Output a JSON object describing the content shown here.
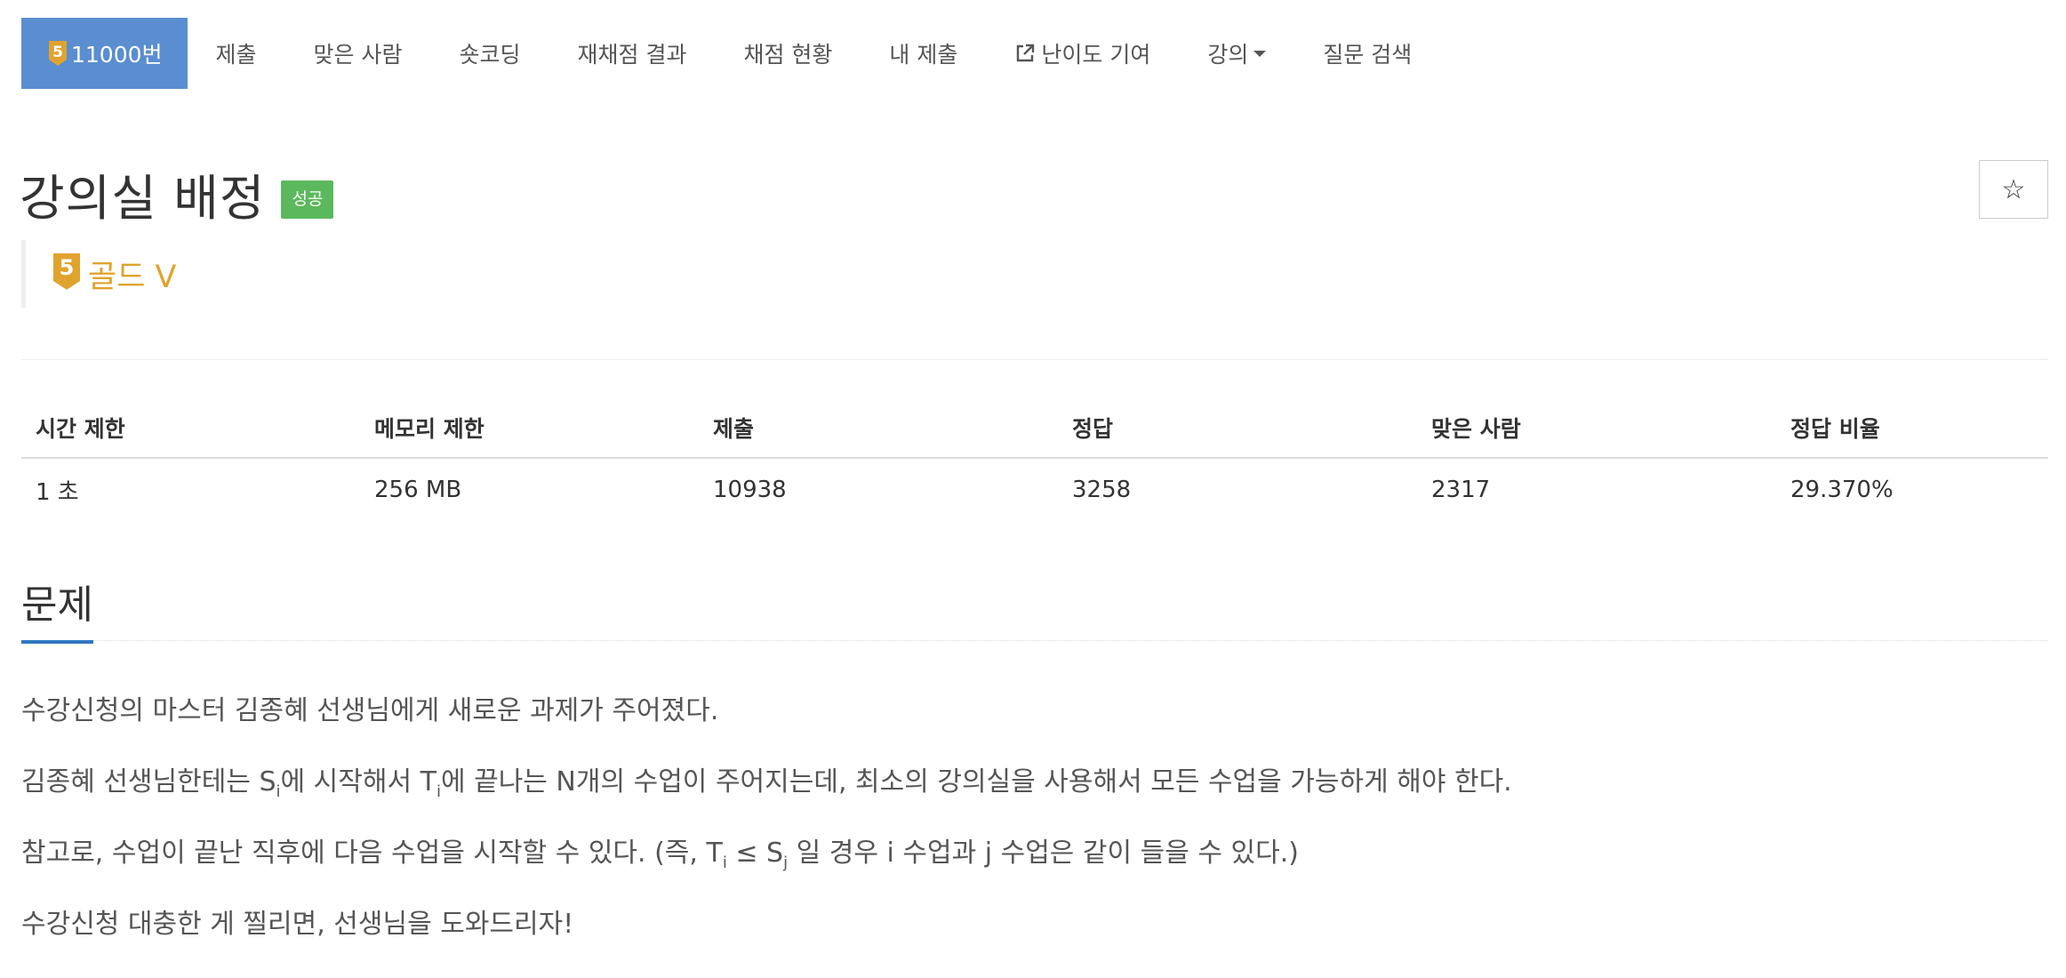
{
  "nav": {
    "problem_number": "11000번",
    "tier_number": "5",
    "items": [
      "제출",
      "맞은 사람",
      "숏코딩",
      "재채점 결과",
      "채점 현황",
      "내 제출",
      "난이도 기여",
      "강의",
      "질문 검색"
    ]
  },
  "title": "강의실 배정",
  "status_badge": "성공",
  "tier": {
    "number": "5",
    "label": "골드 V",
    "color": "#e0a32e"
  },
  "star_icon": "☆",
  "info_table": {
    "headers": [
      "시간 제한",
      "메모리 제한",
      "제출",
      "정답",
      "맞은 사람",
      "정답 비율"
    ],
    "values": [
      "1 초",
      "256 MB",
      "10938",
      "3258",
      "2317",
      "29.370%"
    ]
  },
  "section_title": "문제",
  "problem": {
    "p1": "수강신청의 마스터 김종혜 선생님에게 새로운 과제가 주어졌다.",
    "p2": {
      "a": "김종혜 선생님한테는 S",
      "sub1": "i",
      "b": "에 시작해서 T",
      "sub2": "i",
      "c": "에 끝나는 N개의 수업이 주어지는데, 최소의 강의실을 사용해서 모든 수업을 가능하게 해야 한다."
    },
    "p3": {
      "a": "참고로, 수업이 끝난 직후에 다음 수업을 시작할 수 있다. (즉, T",
      "sub1": "i",
      "b": " ≤ S",
      "sub2": "j",
      "c": " 일 경우 i 수업과 j 수업은 같이 들을 수 있다.)"
    },
    "p4": "수강신청 대충한 게 찔리면, 선생님을 도와드리자!"
  },
  "colors": {
    "nav_active": "#5a8ed0",
    "success": "#5cb85c",
    "gold": "#e0a32e",
    "section_underline": "#2f77c1"
  }
}
